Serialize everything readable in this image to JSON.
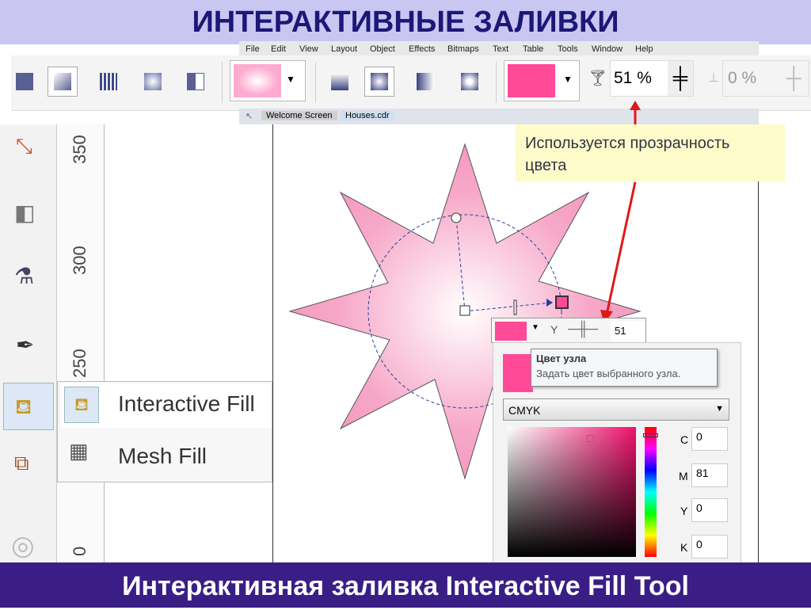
{
  "slide_title": "ИНТЕРАКТИВНЫЕ ЗАЛИВКИ",
  "menu": [
    "File",
    "Edit",
    "View",
    "Layout",
    "Object",
    "Effects",
    "Bitmaps",
    "Text",
    "Table",
    "Tools",
    "Window",
    "Help"
  ],
  "toolbar": {
    "transparency_value": "51 %",
    "second_transparency_value": "0 %",
    "node_color": "#ff4a98"
  },
  "tabs": [
    "Welcome Screen",
    "Houses.cdr"
  ],
  "ruler_labels": [
    "350",
    "300",
    "250",
    "0"
  ],
  "flyout": {
    "items": [
      "Interactive Fill",
      "Mesh Fill"
    ]
  },
  "annotation": "Используется прозрачность цвета",
  "node_bar": {
    "transparency": "51"
  },
  "tooltip": {
    "title": "Цвет узла",
    "text": "Задать цвет выбранного узла."
  },
  "color_picker": {
    "model": "CMYK",
    "C": "0",
    "M": "81",
    "Y": "0",
    "K": "0",
    "labels": {
      "C": "C",
      "M": "M",
      "Y": "Y",
      "K": "K"
    }
  },
  "footer": "Интерактивная заливка Interactive Fill Tool"
}
